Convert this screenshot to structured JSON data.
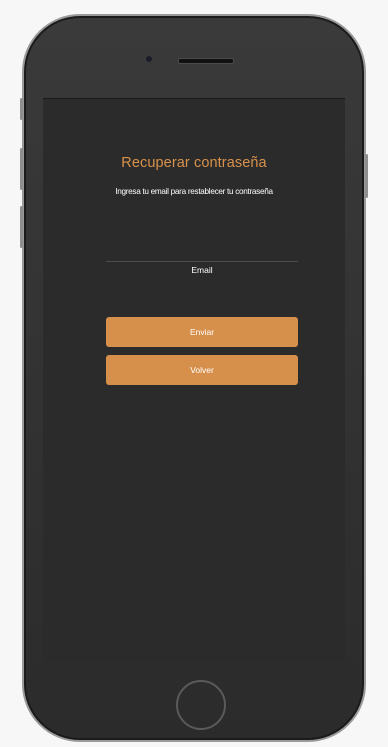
{
  "screen": {
    "title": "Recuperar contraseña",
    "subtitle": "Ingresa tu email para restablecer tu contraseña",
    "email_label": "Email",
    "send_label": "Enviar",
    "back_label": "Volver"
  },
  "colors": {
    "accent": "#d7904b",
    "screen_bg": "#2b2b2b",
    "text": "#ffffff"
  }
}
